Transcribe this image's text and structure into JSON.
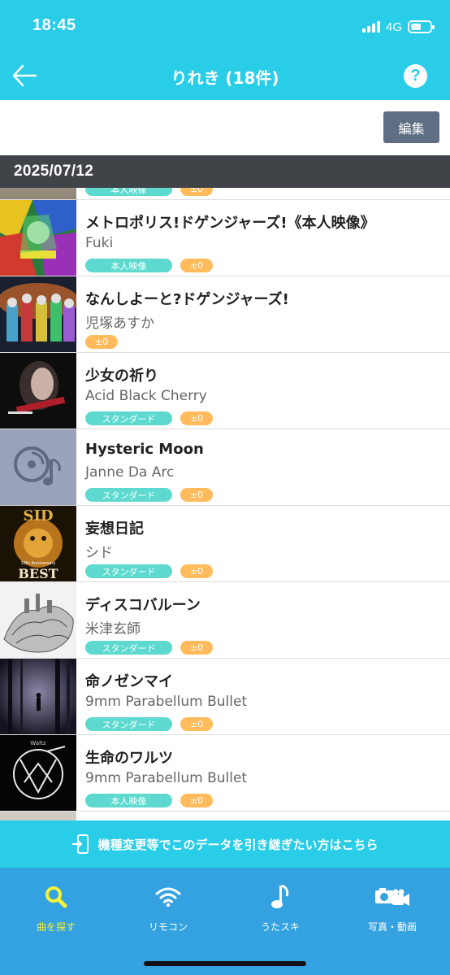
{
  "status_bar": {
    "time": "18:45",
    "network": "4G"
  },
  "nav": {
    "title": "りれき (18件)",
    "help": "?"
  },
  "toolbar": {
    "edit_label": "編集"
  },
  "date_header": "2025/07/12",
  "partial_row": {
    "tag_type": "本人映像",
    "tag_score": "±0"
  },
  "rows": [
    {
      "title": "メトロポリス!ドゲンジャーズ!《本人映像》",
      "artist": "Fuki",
      "tag_type": "本人映像",
      "tag_score": "±0"
    },
    {
      "title": "なんしよーと?ドゲンジャーズ!",
      "artist": "児塚あすか",
      "tag_type": "",
      "tag_score": "±0"
    },
    {
      "title": "少女の祈り",
      "artist": "Acid Black Cherry",
      "tag_type": "スタンダード",
      "tag_score": "±0"
    },
    {
      "title": "Hysteric Moon",
      "artist": "Janne Da Arc",
      "tag_type": "スタンダード",
      "tag_score": "±0"
    },
    {
      "title": "妄想日記",
      "artist": "シド",
      "tag_type": "スタンダード",
      "tag_score": "±0"
    },
    {
      "title": "ディスコバルーン",
      "artist": "米津玄師",
      "tag_type": "スタンダード",
      "tag_score": "±0"
    },
    {
      "title": "命ノゼンマイ",
      "artist": "9mm Parabellum Bullet",
      "tag_type": "スタンダード",
      "tag_score": "±0"
    },
    {
      "title": "生命のワルツ",
      "artist": "9mm Parabellum Bullet",
      "tag_type": "本人映像",
      "tag_score": "±0"
    }
  ],
  "thumb_text": {
    "sid_logo": "SID",
    "sid_sub": "10th Anniversary",
    "sid_best": "BEST",
    "waltz": "Waltz"
  },
  "banner": {
    "text": "機種変更等でこのデータを引き継ぎたい方はこちら"
  },
  "tabs": [
    {
      "label": "曲を探す",
      "icon": "search-icon",
      "active": true
    },
    {
      "label": "リモコン",
      "icon": "wifi-icon",
      "active": false
    },
    {
      "label": "うたスキ",
      "icon": "music-note-icon",
      "active": false
    },
    {
      "label": "写真・動画",
      "icon": "camera-video-icon",
      "active": false
    }
  ],
  "colors": {
    "primary": "#29cde8",
    "tab_bar": "#34a2e0",
    "active_tab": "#f5f23a",
    "tag_type": "#5ed9cf",
    "tag_score": "#ffbb5c",
    "date_header": "#404348",
    "edit_button": "#5f6e83"
  }
}
